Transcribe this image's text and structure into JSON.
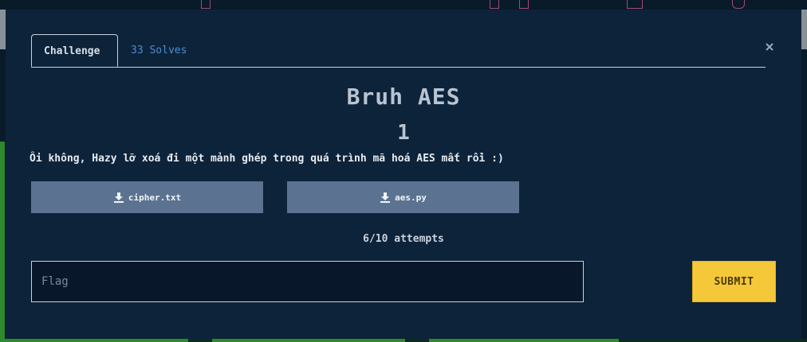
{
  "tabs": {
    "challenge": "Challenge",
    "solves": "33 Solves"
  },
  "close_icon": "close-icon",
  "challenge": {
    "name": "Bruh AES",
    "points": "1",
    "description": "Ôi không, Hazy lỡ xoá đi một mảnh ghép trong quá trình mã hoá AES mất rồi :)"
  },
  "files": [
    {
      "name": "cipher.txt",
      "icon": "download-icon"
    },
    {
      "name": "aes.py",
      "icon": "download-icon"
    }
  ],
  "attempts": "6/10 attempts",
  "flag": {
    "placeholder": "Flag",
    "value": ""
  },
  "submit_label": "SUBMIT",
  "colors": {
    "modal_bg": "#0d233a",
    "file_button": "#5b7391",
    "submit": "#f5c83a",
    "solves_link": "#4a8fd0"
  }
}
